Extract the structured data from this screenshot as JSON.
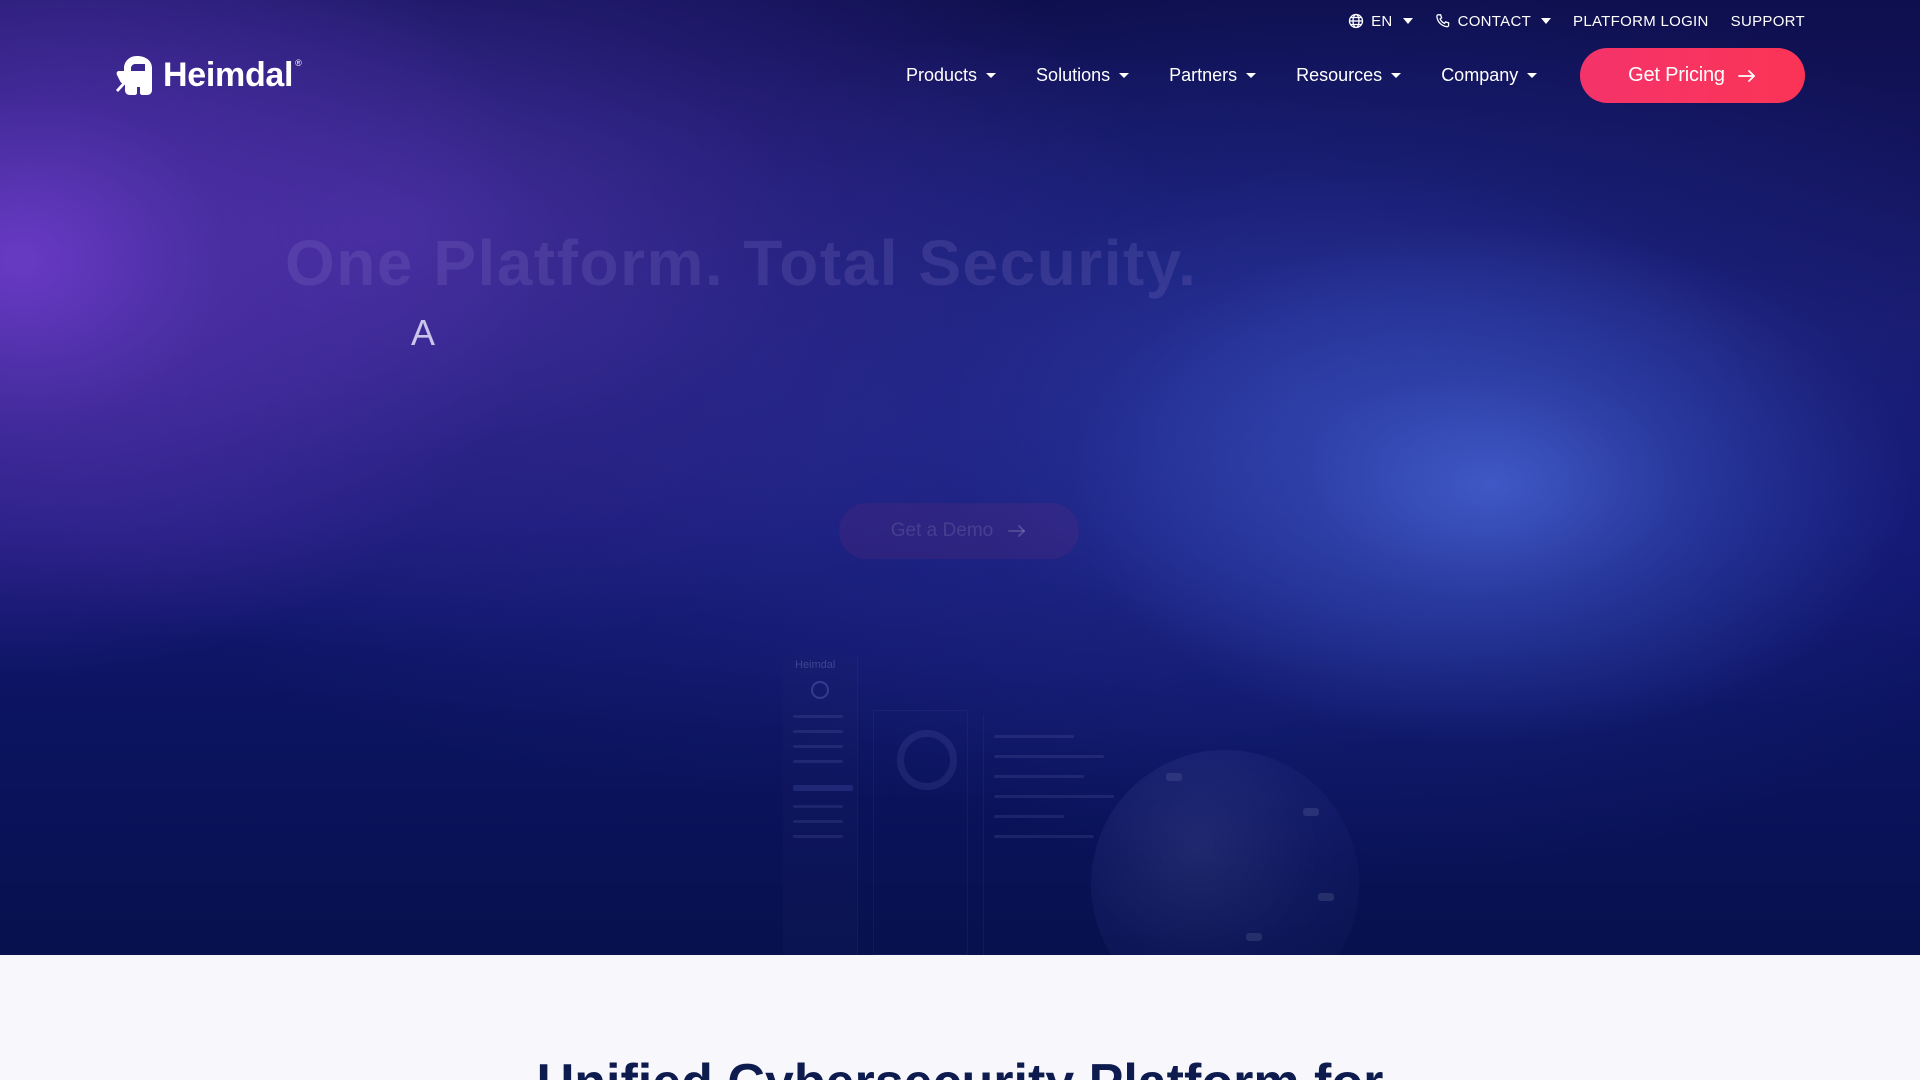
{
  "utility_bar": {
    "language_label": "EN",
    "contact_label": "CONTACT",
    "platform_login_label": "PLATFORM LOGIN",
    "support_label": "SUPPORT",
    "icons": {
      "language": "globe-icon",
      "contact": "phone-icon"
    }
  },
  "logo": {
    "text": "Heimdal",
    "registered": "®",
    "icon": "heimdal-warrior-icon"
  },
  "nav": {
    "items": [
      {
        "label": "Products"
      },
      {
        "label": "Solutions"
      },
      {
        "label": "Partners"
      },
      {
        "label": "Resources"
      },
      {
        "label": "Company"
      }
    ]
  },
  "cta": {
    "label": "Get Pricing",
    "icon": "arrow-right-icon"
  },
  "hero": {
    "title": "One Platform. Total Security.",
    "typing_text": "A",
    "demo_button_label": "Get a Demo",
    "dashboard": {
      "brand": "Heimdal"
    }
  },
  "lower": {
    "title": "Unified Cybersecurity Platform for"
  },
  "colors": {
    "cta": "#f4336a",
    "hero_dark": "#0e0f4e",
    "hero_purple": "#6c3cc8",
    "hero_blue": "#4460ce",
    "lower_bg": "#f8f8fc",
    "lower_title": "#0d1b4f"
  }
}
